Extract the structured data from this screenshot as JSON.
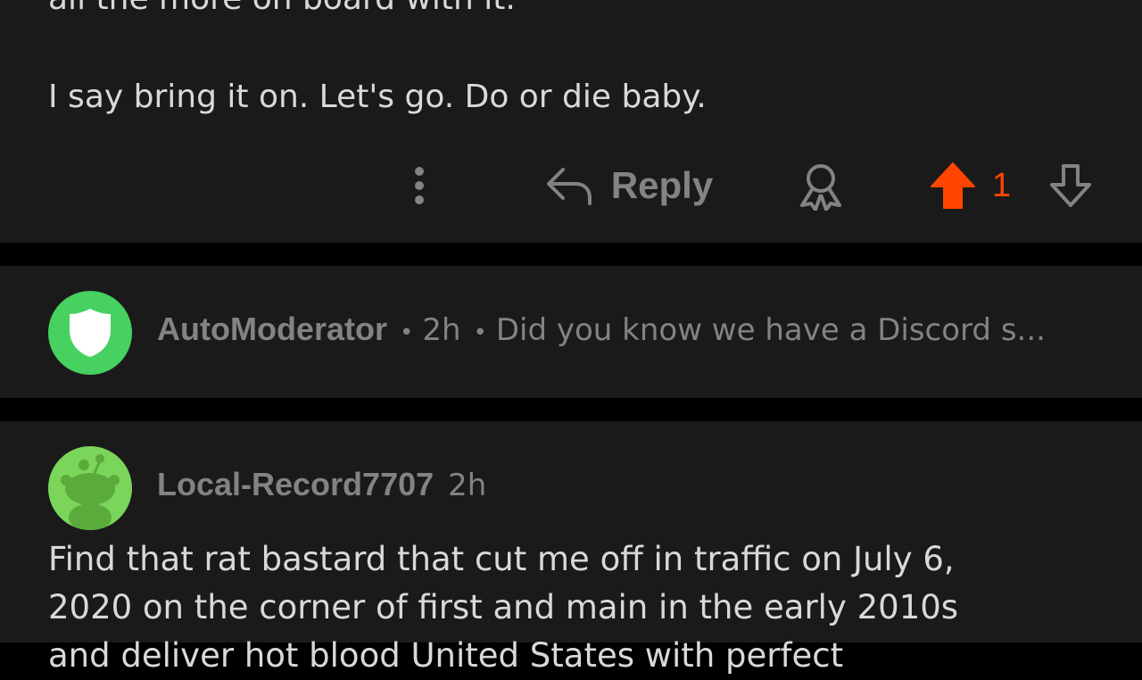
{
  "post_comment": {
    "partial_line": "all the more on board with it.",
    "line": "I say bring it on. Let's go. Do or die baby.",
    "actions": {
      "reply_label": "Reply",
      "vote_count": "1",
      "more_icon": "more-vertical-icon",
      "reply_icon": "reply-arrow-icon",
      "award_icon": "award-icon",
      "upvote_icon": "upvote-arrow-icon",
      "downvote_icon": "downvote-arrow-icon"
    }
  },
  "automod_comment": {
    "username": "AutoModerator",
    "time": "2h",
    "preview": "Did you know we have a Discord s...",
    "avatar_icon": "shield-icon"
  },
  "reply_comment": {
    "username": "Local-Record7707",
    "time": "2h",
    "avatar_icon": "snoo-avatar-icon",
    "lines": [
      "Find that rat bastard that cut me off in traffic on July 6,",
      "2020 on the corner of first and main in the early 2010s",
      "and deliver hot blood United States with perfect"
    ]
  },
  "colors": {
    "background": "#000000",
    "card": "#1a1a1b",
    "text": "#d7dadc",
    "muted": "#818384",
    "upvote": "#ff4500",
    "automod_green": "#46d160",
    "avatar_green": "#7ad55a"
  }
}
